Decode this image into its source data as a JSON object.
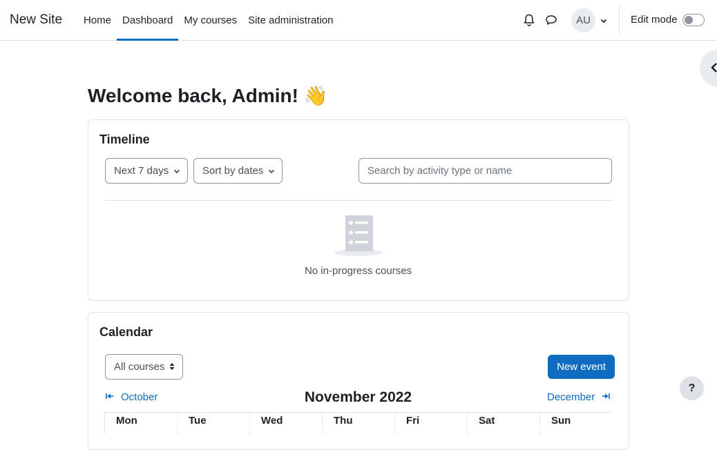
{
  "navbar": {
    "brand": "New Site",
    "items": [
      {
        "label": "Home",
        "active": false
      },
      {
        "label": "Dashboard",
        "active": true
      },
      {
        "label": "My courses",
        "active": false
      },
      {
        "label": "Site administration",
        "active": false
      }
    ],
    "user_initials": "AU",
    "edit_mode_label": "Edit mode",
    "edit_mode_on": false
  },
  "page": {
    "welcome": "Welcome back, Admin! 👋"
  },
  "timeline": {
    "title": "Timeline",
    "filter_selected": "Next 7 days",
    "sort_selected": "Sort by dates",
    "search_placeholder": "Search by activity type or name",
    "empty_message": "No in-progress courses"
  },
  "calendar": {
    "title": "Calendar",
    "course_filter": "All courses",
    "new_event_label": "New event",
    "prev_month": "October",
    "current_month": "November 2022",
    "next_month": "December",
    "weekdays": [
      "Mon",
      "Tue",
      "Wed",
      "Thu",
      "Fri",
      "Sat",
      "Sun"
    ]
  },
  "help": {
    "label": "?"
  },
  "colors": {
    "accent": "#0f6cbf",
    "text": "#1d2125",
    "border": "#dee2e6"
  }
}
